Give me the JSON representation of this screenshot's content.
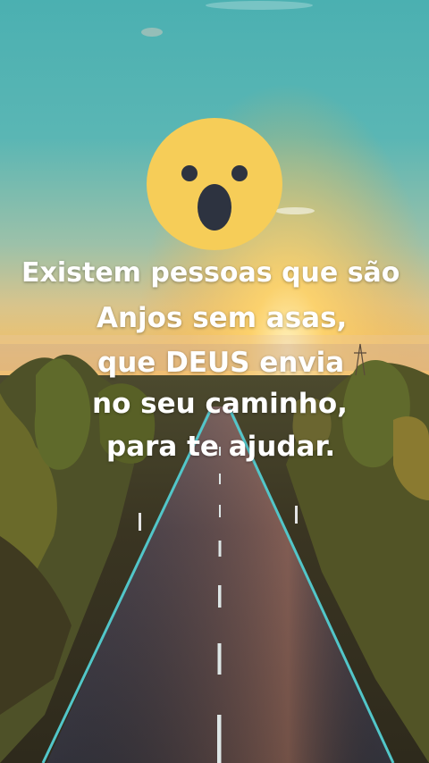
{
  "quote": {
    "line1": "Existem pessoas que são",
    "line2": "Anjos sem asas,",
    "line3": "que DEUS envia",
    "line4": "no seu caminho,",
    "line5": "para te ajudar."
  },
  "emoji": {
    "icon": "astonished-face-icon",
    "color": "#F6CD58",
    "feature_color": "#2D3340"
  },
  "colors": {
    "sky_top": "#49AFAF",
    "sun_glow": "#FCBE45",
    "road": "#3A3A42",
    "road_edge": "#52C6C9"
  }
}
